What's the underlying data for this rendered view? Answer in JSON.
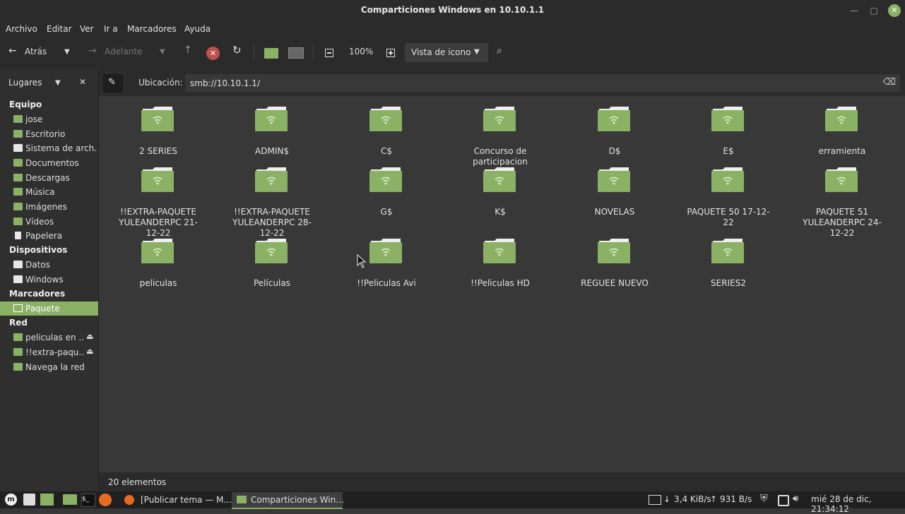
{
  "window": {
    "title": "Comparticiones Windows en 10.10.1.1"
  },
  "menu": [
    "Archivo",
    "Editar",
    "Ver",
    "Ir a",
    "Marcadores",
    "Ayuda"
  ],
  "toolbar": {
    "back": "Atrás",
    "forward": "Adelante",
    "zoom": "100%",
    "view_mode": "Vista de icono"
  },
  "sidebar": {
    "header": "Lugares",
    "sections": [
      {
        "title": "Equipo",
        "items": [
          {
            "label": "jose",
            "icon": "folder-home-icon"
          },
          {
            "label": "Escritorio",
            "icon": "folder-icon"
          },
          {
            "label": "Sistema de arch…",
            "icon": "drive-icon"
          },
          {
            "label": "Documentos",
            "icon": "folder-icon"
          },
          {
            "label": "Descargas",
            "icon": "folder-download-icon"
          },
          {
            "label": "Música",
            "icon": "folder-music-icon"
          },
          {
            "label": "Imágenes",
            "icon": "folder-pictures-icon"
          },
          {
            "label": "Vídeos",
            "icon": "folder-videos-icon"
          },
          {
            "label": "Papelera",
            "icon": "trash-icon"
          }
        ]
      },
      {
        "title": "Dispositivos",
        "items": [
          {
            "label": "Datos",
            "icon": "drive-icon"
          },
          {
            "label": "Windows",
            "icon": "drive-icon"
          }
        ]
      },
      {
        "title": "Marcadores",
        "items": [
          {
            "label": "Paquete",
            "icon": "folder-icon",
            "selected": true
          }
        ]
      },
      {
        "title": "Red",
        "items": [
          {
            "label": "peliculas en …",
            "icon": "folder-network-icon",
            "eject": true
          },
          {
            "label": "!!extra-paqu…",
            "icon": "folder-network-icon",
            "eject": true
          },
          {
            "label": "Navega la red",
            "icon": "network-icon"
          }
        ]
      }
    ]
  },
  "location": {
    "label": "Ubicación:",
    "value": "smb://10.10.1.1/"
  },
  "files": [
    "2 SERIES",
    "ADMIN$",
    "C$",
    "Concurso de participacion",
    "D$",
    "E$",
    "erramienta",
    "!!EXTRA-PAQUETE YULEANDERPC 21-12-22",
    "!!EXTRA-PAQUETE YULEANDERPC 28-12-22",
    "G$",
    "K$",
    "NOVELAS",
    "PAQUETE 50  17-12-22",
    "PAQUETE 51 YULEANDERPC 24-12-22",
    "peliculas",
    "Películas",
    "!!Peliculas  Avi",
    "!!Peliculas  HD",
    "REGUEE NUEVO",
    "SERIES2"
  ],
  "status": {
    "count": "20 elementos"
  },
  "taskbar": {
    "windows": [
      "[Publicar tema — M…",
      "Comparticiones Win…"
    ],
    "net_down": "3,4 KiB/s",
    "net_up": "931 B/s",
    "clock": "mié 28 de dic, 21:34:12"
  },
  "colors": {
    "accent": "#8ab164",
    "background": "#383838",
    "bar": "#2b2b2b"
  }
}
